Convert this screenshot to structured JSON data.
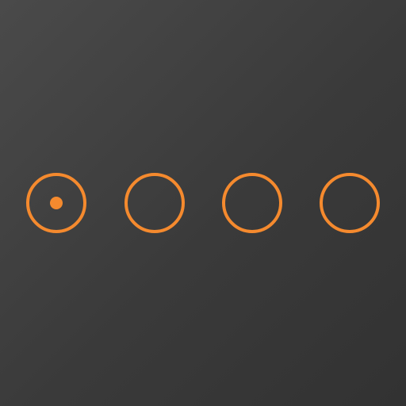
{
  "theme": {
    "background_top": "#4a4a4a",
    "background_bottom": "#323232",
    "accent": "#f58a2e"
  },
  "radio_group": {
    "selected_index": 0,
    "options": [
      {
        "id": "option-1",
        "checked": true,
        "icon": "radio-selected-icon"
      },
      {
        "id": "option-2",
        "checked": false,
        "icon": "radio-empty-icon"
      },
      {
        "id": "option-3",
        "checked": false,
        "icon": "radio-empty-icon"
      },
      {
        "id": "option-4",
        "checked": false,
        "icon": "radio-empty-icon"
      }
    ]
  }
}
